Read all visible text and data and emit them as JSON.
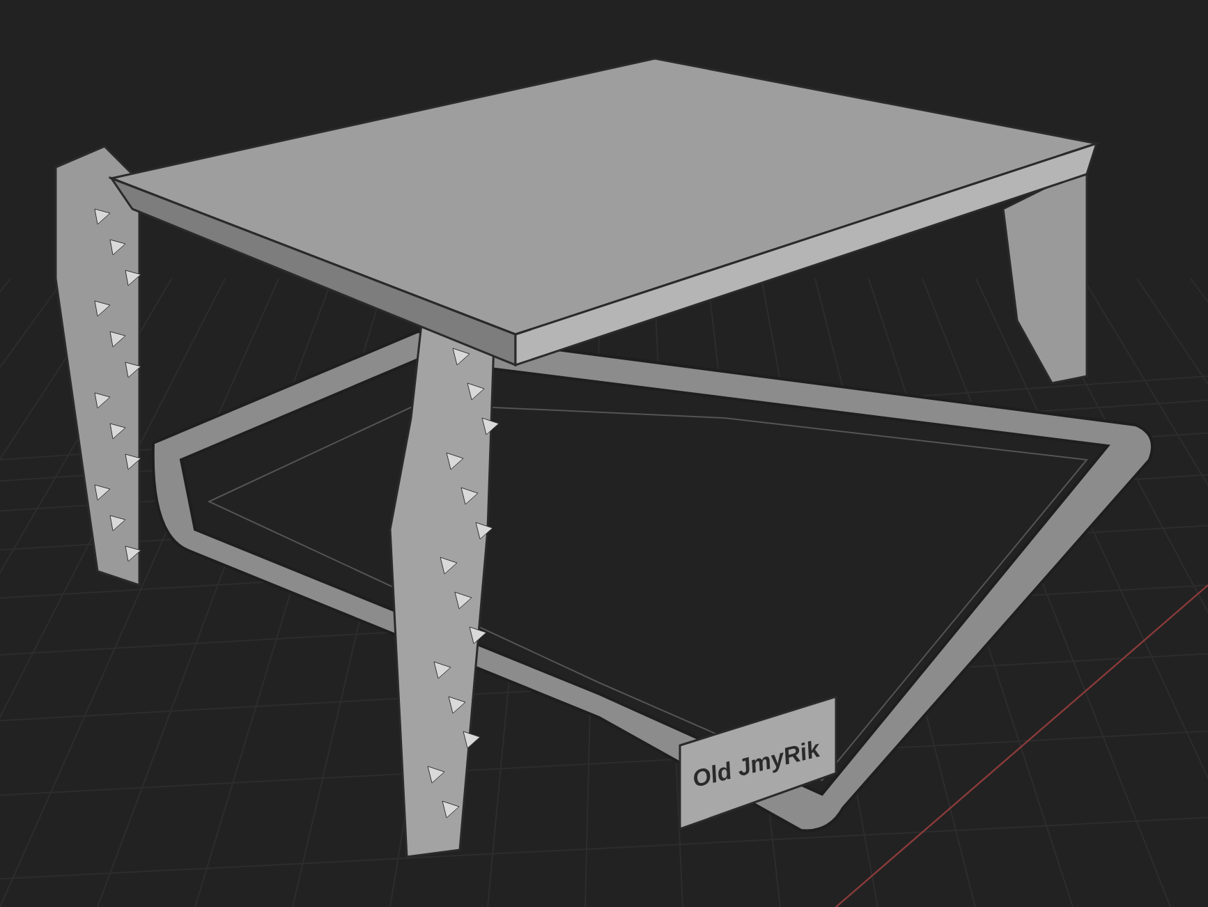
{
  "viewport": {
    "model_label": "Old JmyRik"
  }
}
